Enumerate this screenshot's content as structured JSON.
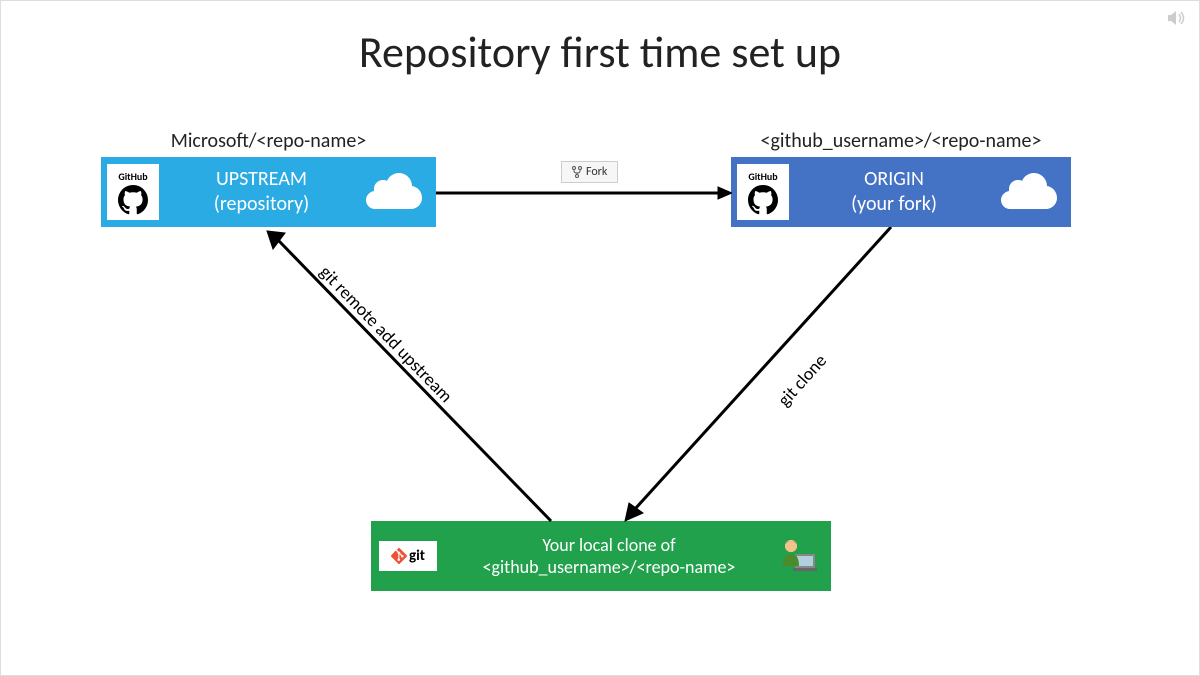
{
  "title": "Repository first time set up",
  "upstream": {
    "label": "Microsoft/<repo-name>",
    "box_line1": "UPSTREAM",
    "box_line2": "(repository)",
    "badge": "GitHub"
  },
  "origin": {
    "label": "<github_username>/<repo-name>",
    "box_line1": "ORIGIN",
    "box_line2": "(your fork)",
    "badge": "GitHub"
  },
  "local": {
    "box_line1": "Your local clone of",
    "box_line2": "<github_username>/<repo-name>",
    "badge": "git"
  },
  "actions": {
    "fork": "Fork",
    "clone": "git clone",
    "remote_add": "git remote add upstream"
  },
  "colors": {
    "upstream_bg": "#2aabe4",
    "origin_bg": "#4472c4",
    "local_bg": "#21a14c"
  }
}
